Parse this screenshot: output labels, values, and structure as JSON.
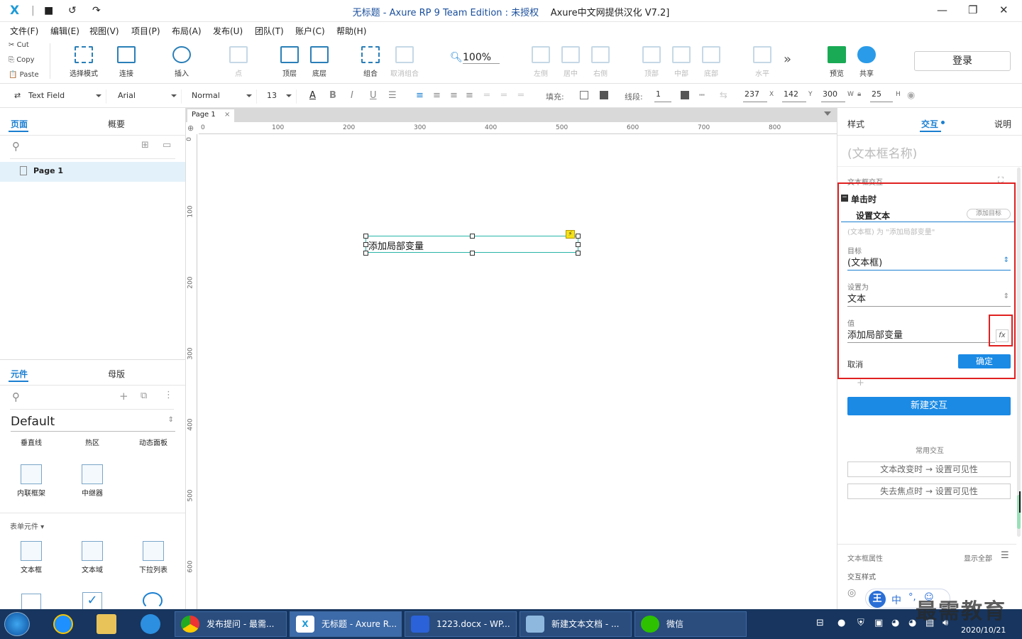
{
  "titlebar": {
    "title_main": "无标题 - Axure RP 9 Team Edition : 未授权",
    "title_extra": "Axure中文网提供汉化 V7.2]"
  },
  "menu": [
    "文件(F)",
    "编辑(E)",
    "视图(V)",
    "项目(P)",
    "布局(A)",
    "发布(U)",
    "团队(T)",
    "账户(C)",
    "帮助(H)"
  ],
  "clipboard": {
    "cut": "Cut",
    "copy": "Copy",
    "paste": "Paste"
  },
  "toolbar": {
    "select_mode": "选择模式",
    "connect": "连接",
    "insert": "插入",
    "point": "点",
    "top": "顶层",
    "bottom": "底层",
    "group": "组合",
    "ungroup": "取消组合",
    "zoom": "100%",
    "align_left": "左侧",
    "align_center": "居中",
    "align_right": "右侧",
    "align_top": "顶部",
    "align_middle": "中部",
    "align_bottom": "底部",
    "distribute_h": "水平",
    "preview": "预览",
    "share": "共享",
    "login": "登录"
  },
  "format": {
    "widget_type": "Text Field",
    "font": "Arial",
    "weight": "Normal",
    "size": "13",
    "fill_label": "填充:",
    "line_label": "线段:",
    "line_width": "1",
    "x": "237",
    "x_label": "X",
    "y": "142",
    "y_label": "Y",
    "w": "300",
    "w_label": "W",
    "h": "25",
    "h_label": "H"
  },
  "left": {
    "tab_pages": "页面",
    "tab_outline": "概要",
    "page1": "Page 1",
    "tab_widgets": "元件",
    "tab_masters": "母版",
    "library": "Default",
    "widgets_row1": [
      "垂直线",
      "热区",
      "动态面板"
    ],
    "widgets_row2": [
      "内联框架",
      "中继器"
    ],
    "form_section": "表单元件",
    "widgets_row3": [
      "文本框",
      "文本域",
      "下拉列表"
    ]
  },
  "canvas": {
    "page_tab": "Page 1",
    "ruler_h": [
      "0",
      "100",
      "200",
      "300",
      "400",
      "500",
      "600",
      "700",
      "800"
    ],
    "ruler_v": [
      "0",
      "100",
      "200",
      "300",
      "400",
      "500",
      "600"
    ],
    "textbox_text": "添加局部变量"
  },
  "right": {
    "tab_style": "样式",
    "tab_interact": "交互",
    "tab_notes": "说明",
    "widget_name_placeholder": "(文本框名称)",
    "section": "文本框交互",
    "event": "单击时",
    "action": "设置文本",
    "add_target": "添加目标",
    "summary": "(文本框) 为 \"添加局部变量\"",
    "target_label": "目标",
    "target_value": "(文本框)",
    "setto_label": "设置为",
    "setto_value": "文本",
    "value_label": "值",
    "value_value": "添加局部变量",
    "fx": "fx",
    "cancel": "取消",
    "ok": "确定",
    "new_interaction": "新建交互",
    "common": "常用交互",
    "common1": "文本改变时 → 设置可见性",
    "common2": "失去焦点时 → 设置可见性",
    "props": "文本框属性",
    "show_all": "显示全部",
    "interact_style": "交互样式"
  },
  "taskbar": {
    "apps": [
      "发布提问 - 最需...",
      "无标题 - Axure R...",
      "1223.docx - WP...",
      "新建文本文档 - ...",
      "微信"
    ],
    "date": "2020/10/21",
    "ime": "中",
    "watermark": "最需教育"
  },
  "colors": {
    "accent": "#1a7fd1",
    "primary_button": "#1a8ae5",
    "highlight": "#e02020",
    "selection": "#28b4a8"
  }
}
